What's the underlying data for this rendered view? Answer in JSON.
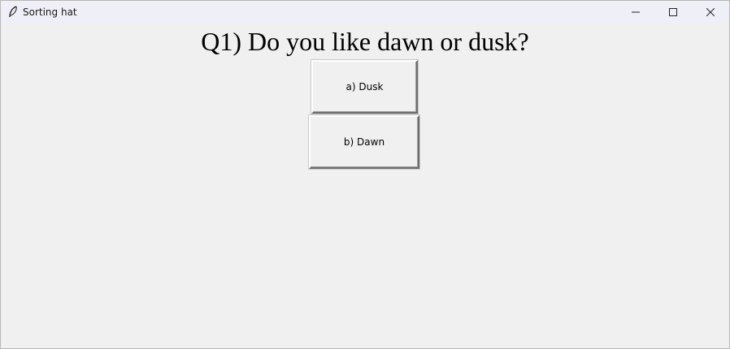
{
  "window": {
    "title": "Sorting hat",
    "icon": "feather-icon",
    "controls": [
      "minimize-icon",
      "maximize-icon",
      "close-icon"
    ]
  },
  "question": {
    "text": "Q1) Do you like dawn or dusk?"
  },
  "answers": [
    {
      "label": "a) Dusk"
    },
    {
      "label": "b) Dawn"
    }
  ],
  "colors": {
    "background": "#f0f0f0",
    "titlebar": "#eff0f7",
    "text": "#000000"
  }
}
